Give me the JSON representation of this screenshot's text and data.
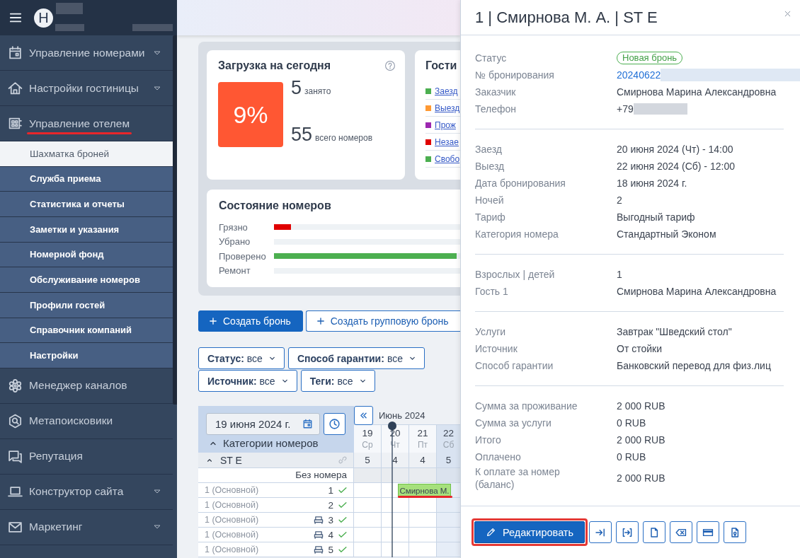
{
  "sidebar": {
    "brand": {
      "logo_letter": "H",
      "redacted": true
    },
    "items": [
      {
        "label": "Управление номерами",
        "dropdown": true,
        "annotated": false
      },
      {
        "label": "Настройки гостиницы",
        "dropdown": true,
        "annotated": false
      },
      {
        "label": "Управление отелем",
        "dropdown": false,
        "annotated": true,
        "children": [
          {
            "label": "Шахматка броней",
            "selected": true
          },
          {
            "label": "Служба приема",
            "selected": false
          },
          {
            "label": "Статистика и отчеты",
            "selected": false
          },
          {
            "label": "Заметки и указания",
            "selected": false
          },
          {
            "label": "Номерной фонд",
            "selected": false
          },
          {
            "label": "Обслуживание номеров",
            "selected": false
          },
          {
            "label": "Профили гостей",
            "selected": false
          },
          {
            "label": "Справочник компаний",
            "selected": false
          },
          {
            "label": "Настройки",
            "selected": false
          }
        ]
      },
      {
        "label": "Менеджер каналов",
        "dropdown": false,
        "annotated": false
      },
      {
        "label": "Метапоисковики",
        "dropdown": false,
        "annotated": false
      },
      {
        "label": "Репутация",
        "dropdown": false,
        "annotated": false
      },
      {
        "label": "Конструктор сайта",
        "dropdown": true,
        "annotated": false
      },
      {
        "label": "Маркетинг",
        "dropdown": true,
        "annotated": false
      }
    ]
  },
  "dashboard": {
    "occupancy": {
      "title": "Загрузка на сегодня",
      "percent": "9%",
      "occupied": "5",
      "occupied_label": "занято",
      "total": "55",
      "total_label": "всего номеров"
    },
    "guests": {
      "title": "Гости",
      "items": [
        {
          "label": "Заезд",
          "color": "#4caf50"
        },
        {
          "label": "Выезд",
          "color": "#ff9933"
        },
        {
          "label": "Прож",
          "color": "#9c27b0"
        },
        {
          "label": "Незае",
          "color": "#e00000"
        },
        {
          "label": "Свобо",
          "color": "#4caf50"
        }
      ]
    },
    "room_status": {
      "title": "Состояние номеров",
      "rows": [
        {
          "label": "Грязно",
          "level": 0.09,
          "color": "#e00000"
        },
        {
          "label": "Убрано",
          "level": 0
        },
        {
          "label": "Проверено",
          "level": 0.98,
          "color": "#4caf50"
        },
        {
          "label": "Ремонт",
          "level": 0
        }
      ]
    }
  },
  "actions": [
    {
      "label": "Создать бронь",
      "primary": true
    },
    {
      "label": "Создать групповую бронь",
      "primary": false
    }
  ],
  "filters": [
    {
      "label": "Статус:",
      "value": "все"
    },
    {
      "label": "Способ гарантии:",
      "value": "все"
    },
    {
      "label": "Источник:",
      "value": "все"
    },
    {
      "label": "Теги:",
      "value": "все"
    }
  ],
  "calendar": {
    "date_field": {
      "value": "19 июня 2024 г."
    },
    "categories_label": "Категории номеров",
    "categories_expanded": true,
    "month": "Июнь 2024",
    "days": [
      {
        "day": "19",
        "weekday": "Ср",
        "weekend": false,
        "today": false
      },
      {
        "day": "20",
        "weekday": "Чт",
        "weekend": false,
        "today": true
      },
      {
        "day": "21",
        "weekday": "Пт",
        "weekend": false,
        "today": false
      },
      {
        "day": "22",
        "weekday": "Сб",
        "weekend": true,
        "today": false
      }
    ],
    "category": {
      "name": "ST E",
      "expanded": true,
      "counts": [
        "5",
        "4",
        "4",
        "5"
      ]
    },
    "unassigned_label": "Без номера",
    "rooms": [
      {
        "type": "1 (Основной)",
        "number": "1",
        "bed": false,
        "ready": true,
        "booking": {
          "guest": "Смирнова М.",
          "annotated": true
        }
      },
      {
        "type": "1 (Основной)",
        "number": "2",
        "bed": false,
        "ready": true
      },
      {
        "type": "1 (Основной)",
        "number": "3",
        "bed": true,
        "ready": true
      },
      {
        "type": "1 (Основной)",
        "number": "4",
        "bed": true,
        "ready": true
      },
      {
        "type": "1 (Основной)",
        "number": "5",
        "bed": true,
        "ready": true
      }
    ]
  },
  "booking_panel": {
    "title": "1 | Смирнова М. А. | ST E",
    "sections": [
      {
        "rows": [
          {
            "label": "Статус",
            "value": "Новая бронь",
            "kind": "badge",
            "redacted": false
          },
          {
            "label": "№ бронирования",
            "value": "20240622",
            "kind": "link",
            "redacted": true
          },
          {
            "label": "Заказчик",
            "value": "Смирнова Марина Александровна",
            "kind": "text",
            "redacted": false
          },
          {
            "label": "Телефон",
            "value": "+79",
            "kind": "text",
            "redacted": true
          }
        ]
      },
      {
        "rows": [
          {
            "label": "Заезд",
            "value": "20 июня 2024 (Чт) - 14:00",
            "kind": "text",
            "redacted": false
          },
          {
            "label": "Выезд",
            "value": "22 июня 2024 (Сб) - 12:00",
            "kind": "text",
            "redacted": false
          },
          {
            "label": "Дата бронирования",
            "value": "18 июня 2024 г.",
            "kind": "text",
            "redacted": false
          },
          {
            "label": "Ночей",
            "value": "2",
            "kind": "text",
            "redacted": false
          },
          {
            "label": "Тариф",
            "value": "Выгодный тариф",
            "kind": "text",
            "redacted": false
          },
          {
            "label": "Категория номера",
            "value": "Стандартный Эконом",
            "kind": "text",
            "redacted": false
          }
        ]
      },
      {
        "rows": [
          {
            "label": "Взрослых | детей",
            "value": "1",
            "kind": "text",
            "redacted": false
          },
          {
            "label": "Гость 1",
            "value": "Смирнова Марина Александровна",
            "kind": "text",
            "redacted": false
          }
        ]
      },
      {
        "rows": [
          {
            "label": "Услуги",
            "value": "Завтрак \"Шведский стол\"",
            "kind": "text",
            "redacted": false
          },
          {
            "label": "Источник",
            "value": "От стойки",
            "kind": "text",
            "redacted": false
          },
          {
            "label": "Способ гарантии",
            "value": "Банковский перевод для физ.лиц",
            "kind": "text",
            "redacted": false
          }
        ]
      },
      {
        "rows": [
          {
            "label": "Сумма за проживание",
            "value": "2 000 RUB",
            "kind": "text",
            "redacted": false
          },
          {
            "label": "Сумма за услуги",
            "value": "0 RUB",
            "kind": "text",
            "redacted": false
          },
          {
            "label": "Итого",
            "value": "2 000 RUB",
            "kind": "text",
            "redacted": false
          },
          {
            "label": "Оплачено",
            "value": "0 RUB",
            "kind": "text",
            "redacted": false
          },
          {
            "label": "К оплате за номер (баланс)",
            "value": "2 000 RUB",
            "kind": "text",
            "redacted": false
          }
        ]
      }
    ],
    "edit_button": {
      "label": "Редактировать",
      "annotated": true
    }
  }
}
